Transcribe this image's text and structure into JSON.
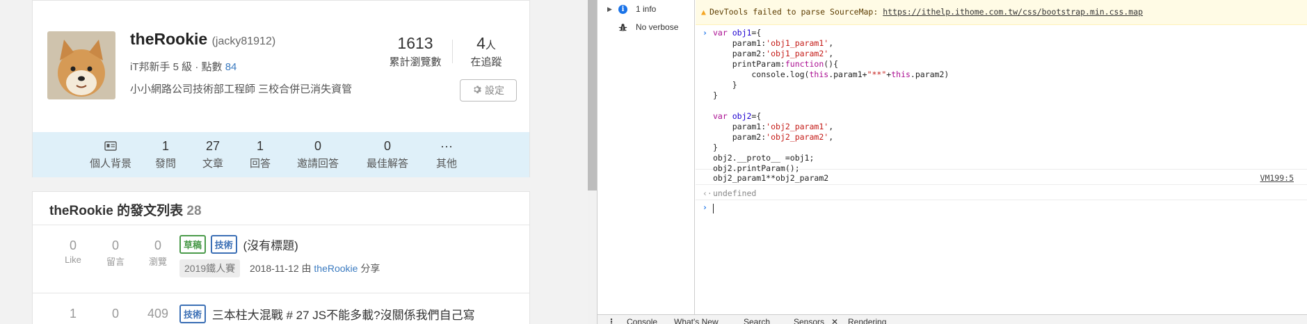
{
  "profile": {
    "username": "theRookie",
    "handle": "(jacky81912)",
    "rank_text": "iT邦新手 5 級 · 點數",
    "points": "84",
    "bio": "小小網路公司技術部工程師 三校合併已消失資管",
    "total_views": "1613",
    "total_views_label": "累計瀏覽數",
    "followers": "4",
    "followers_unit": "人",
    "followers_label": "在追蹤",
    "settings_label": "設定"
  },
  "stats_bar": [
    {
      "value": "",
      "label": "個人背景",
      "icon": "id-card-icon"
    },
    {
      "value": "1",
      "label": "發問"
    },
    {
      "value": "27",
      "label": "文章"
    },
    {
      "value": "1",
      "label": "回答"
    },
    {
      "value": "0",
      "label": "邀請回答"
    },
    {
      "value": "0",
      "label": "最佳解答"
    },
    {
      "value": "···",
      "label": "其他"
    }
  ],
  "posts": {
    "header": "theRookie 的發文列表",
    "count": "28",
    "stat_labels": [
      "Like",
      "留言",
      "瀏覽"
    ],
    "items": [
      {
        "stats": [
          "0",
          "0",
          "0"
        ],
        "tags": [
          "草稿",
          "技術"
        ],
        "title": "(沒有標題)",
        "series": "2019鐵人賽",
        "date": "2018-11-12",
        "by": "由",
        "author": "theRookie",
        "action": "分享"
      },
      {
        "stats": [
          "1",
          "0",
          "409"
        ],
        "tags": [
          "技術"
        ],
        "title": "三本柱大混戰 # 27 JS不能多載?沒關係我們自己寫"
      }
    ]
  },
  "devtools": {
    "sidebar": [
      {
        "label": "1 info",
        "icon": "info-icon"
      },
      {
        "label": "No verbose",
        "icon": "bug-icon"
      }
    ],
    "warning_text": "DevTools failed to parse SourceMap:",
    "warning_link": "https://ithelp.ithome.com.tw/css/bootstrap.min.css.map",
    "log_output": "obj2_param1**obj2_param2",
    "log_source": "VM199:5",
    "result": "undefined",
    "drawer_tabs": [
      "Console",
      "What's New",
      "Search",
      "Sensors",
      "Rendering"
    ]
  },
  "colors": {
    "stats_bar_bg": "#dff0f9",
    "link_blue": "#3b7bc0",
    "draft_green": "#4a9a4a",
    "tech_blue": "#3b6fb5",
    "warning_bg": "#fffbe5"
  }
}
